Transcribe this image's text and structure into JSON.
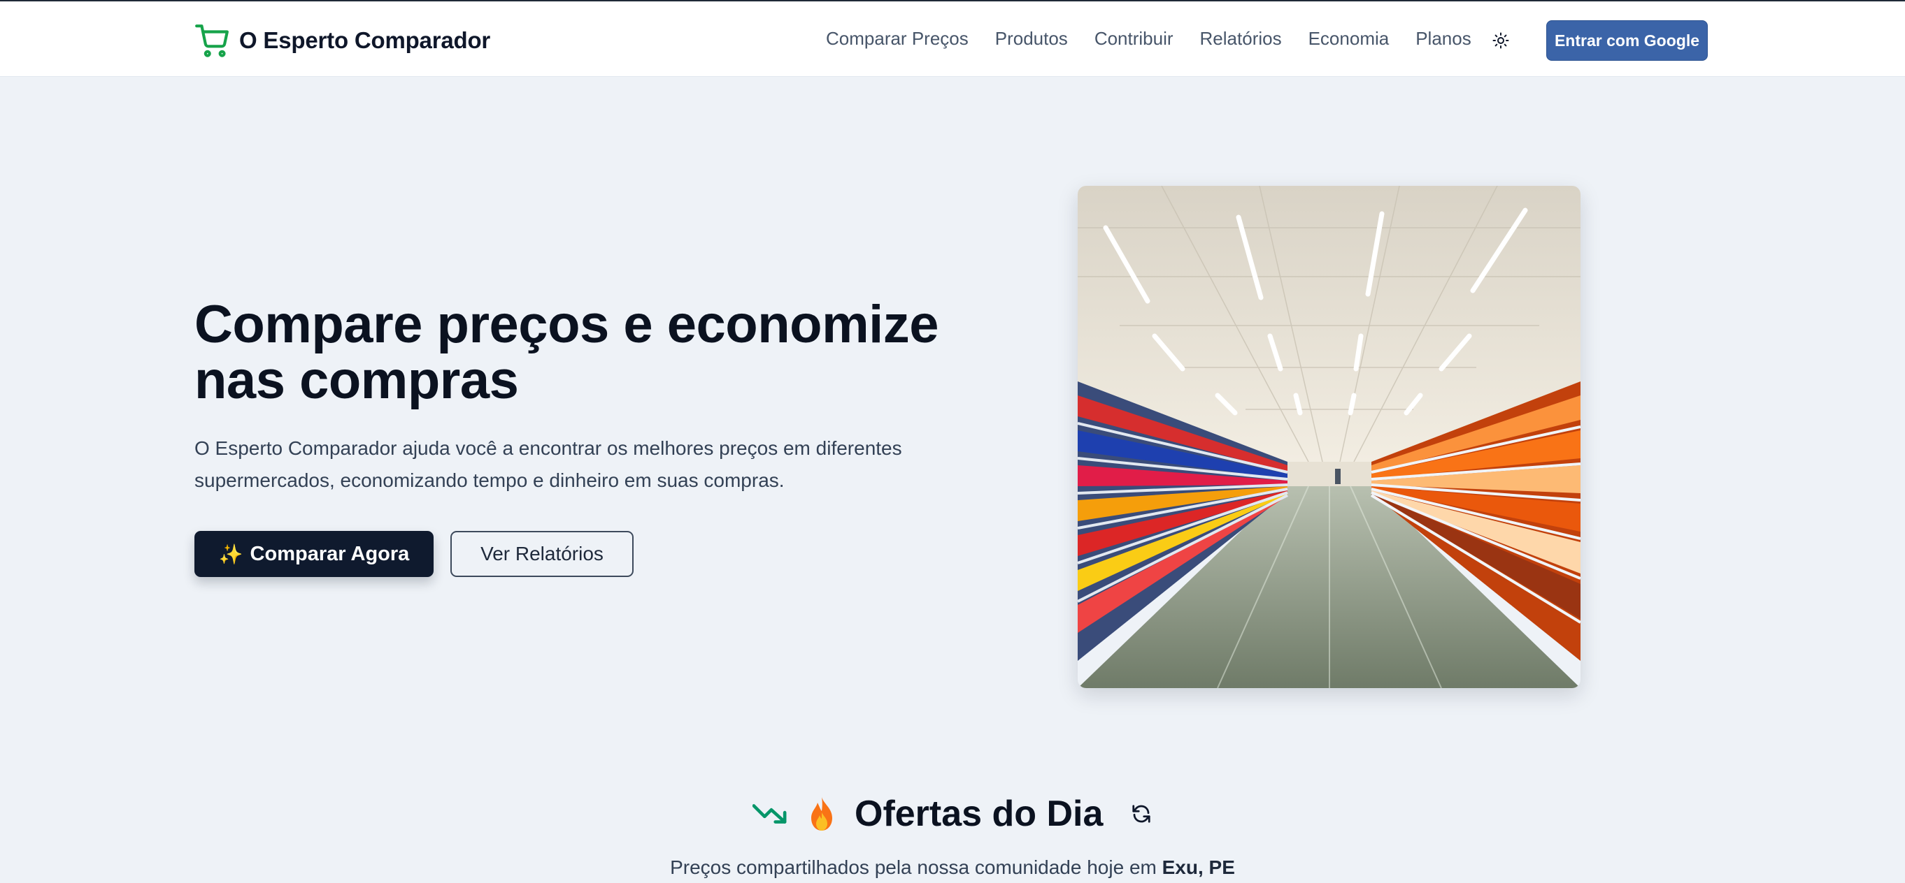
{
  "header": {
    "brand_name": "O Esperto Comparador",
    "nav": [
      {
        "label": "Comparar Preços"
      },
      {
        "label": "Produtos"
      },
      {
        "label": "Contribuir"
      },
      {
        "label": "Relatórios"
      },
      {
        "label": "Economia"
      },
      {
        "label": "Planos"
      }
    ],
    "theme_icon": "sun-icon",
    "login_label": "Entrar com Google",
    "brand_color": "#16a34a",
    "login_color": "#3b64a8"
  },
  "hero": {
    "title": "Compare preços e economize nas compras",
    "subtitle": "O Esperto Comparador ajuda você a encontrar os melhores preços em diferentes supermercados, economizando tempo e dinheiro em suas compras.",
    "primary_button": "Comparar Agora",
    "primary_icon": "sparkles-icon",
    "secondary_button": "Ver Relatórios",
    "image_subject": "supermarket-aisle-photo"
  },
  "deals": {
    "title": "Ofertas do Dia",
    "subtitle_prefix": "Preços compartilhados pela nossa comunidade hoje em ",
    "location": "Exu, PE",
    "icons": [
      "trending-down-icon",
      "fire-icon",
      "refresh-icon"
    ]
  }
}
